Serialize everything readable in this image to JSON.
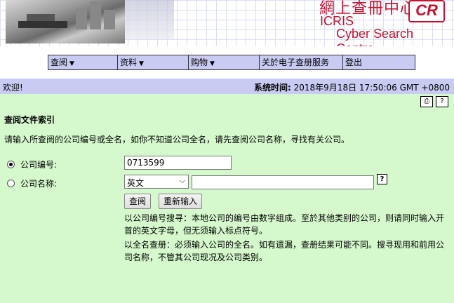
{
  "banner": {
    "title_cn": "網上查冊中心",
    "logo": "CR",
    "icris": "ICRIS",
    "subtitle": "Cyber Search Centre"
  },
  "menu": [
    {
      "label": "查阅",
      "has_dropdown": true
    },
    {
      "label": "资料",
      "has_dropdown": true
    },
    {
      "label": "购物",
      "has_dropdown": true
    },
    {
      "label": "关於电子查册服务",
      "has_dropdown": false
    },
    {
      "label": "登出",
      "has_dropdown": false
    }
  ],
  "status": {
    "welcome": "欢迎!",
    "systime_label": "系统时间:",
    "systime_value": "2018年9月18日 17:50:06 GMT +0800"
  },
  "form": {
    "section_title": "查阅文件索引",
    "intro": "请输入所查阅的公司编号或全名，如你不知道公司全名，请先查阅公司名称，寻找有关公司。",
    "company_no_label": "公司编号:",
    "company_no_value": "0713599",
    "company_name_label": "公司名称:",
    "language_selected": "英文",
    "company_name_value": "",
    "search_button": "查阅",
    "reset_button": "重新输入",
    "note1": "以公司编号搜寻：本地公司的编号由数字组成。至於其他类别的公司，则请同时输入开首的英文字母，但无须输入标点符号。",
    "note2": "以全名查册：必须输入公司的全名。如有遗漏，查册结果可能不同。搜寻现用和前用公司名称，不管其公司现况及公司类别。",
    "company_no_checked": true
  },
  "icons": {
    "print": "printer-icon",
    "help": "help-icon"
  }
}
